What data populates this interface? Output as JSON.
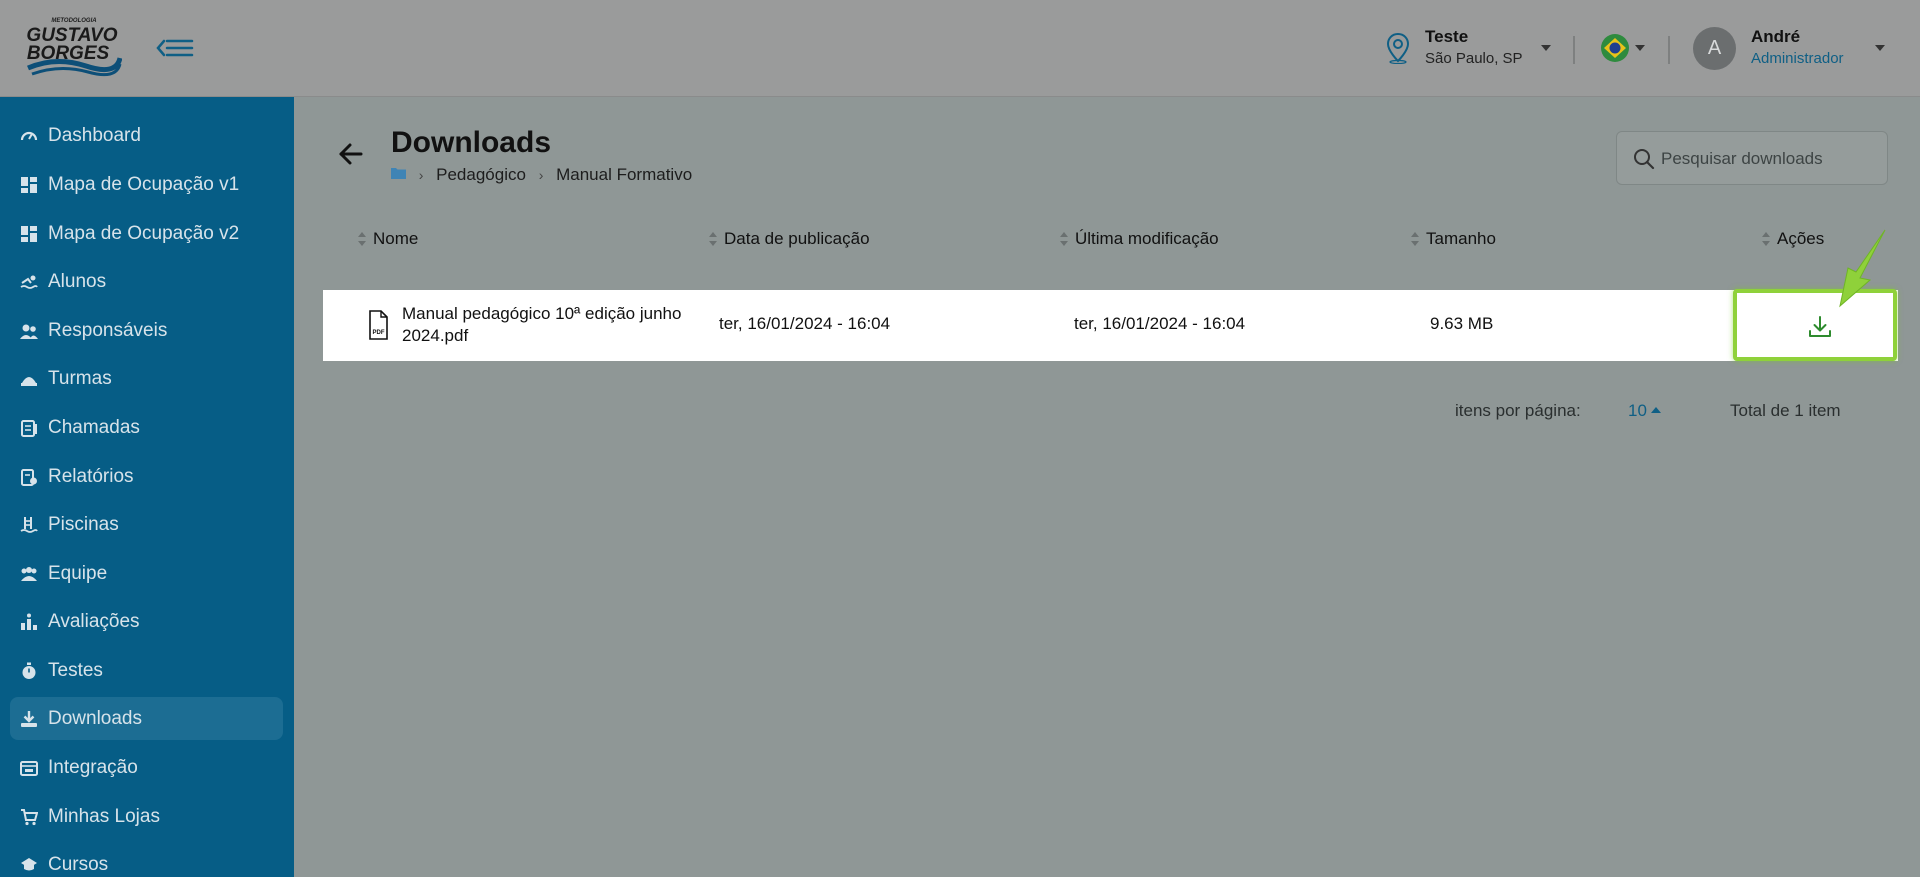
{
  "header": {
    "logo_top": "METODOLOGIA",
    "logo_line1": "GUSTAVO",
    "logo_line2": "BORGES",
    "school_name": "Teste",
    "school_location": "São Paulo, SP",
    "user_initial": "A",
    "user_name": "André",
    "user_role": "Administrador"
  },
  "sidebar": {
    "items": [
      {
        "label": "Dashboard",
        "icon": "dashboard-icon"
      },
      {
        "label": "Mapa de Ocupação v1",
        "icon": "grid-icon"
      },
      {
        "label": "Mapa de Ocupação v2",
        "icon": "grid-icon"
      },
      {
        "label": "Alunos",
        "icon": "swimmer-icon"
      },
      {
        "label": "Responsáveis",
        "icon": "users-icon"
      },
      {
        "label": "Turmas",
        "icon": "class-icon"
      },
      {
        "label": "Chamadas",
        "icon": "clipboard-icon"
      },
      {
        "label": "Relatórios",
        "icon": "report-icon"
      },
      {
        "label": "Piscinas",
        "icon": "pool-icon"
      },
      {
        "label": "Equipe",
        "icon": "team-icon"
      },
      {
        "label": "Avaliações",
        "icon": "evaluation-icon"
      },
      {
        "label": "Testes",
        "icon": "stopwatch-icon"
      },
      {
        "label": "Downloads",
        "icon": "download-icon"
      },
      {
        "label": "Integração",
        "icon": "integration-icon"
      },
      {
        "label": "Minhas Lojas",
        "icon": "cart-icon"
      },
      {
        "label": "Cursos",
        "icon": "graduation-icon"
      }
    ],
    "active": "Downloads"
  },
  "main": {
    "title": "Downloads",
    "breadcrumb": [
      "Pedagógico",
      "Manual Formativo"
    ],
    "search_placeholder": "Pesquisar downloads",
    "columns": [
      "Nome",
      "Data de publicação",
      "Última modificação",
      "Tamanho",
      "Ações"
    ],
    "rows": [
      {
        "name": "Manual pedagógico 10ª edição junho 2024.pdf",
        "file_type": "PDF",
        "published": "ter, 16/01/2024 - 16:04",
        "modified": "ter, 16/01/2024 - 16:04",
        "size": "9.63 MB"
      }
    ],
    "pagination": {
      "per_page_label": "itens por página:",
      "per_page_value": "10",
      "total_label": "Total de 1 item"
    }
  },
  "colors": {
    "sidebar": "#065d86",
    "accent": "#0f5f85",
    "highlight": "#8fd13a",
    "download_icon": "#2e8b2e"
  }
}
